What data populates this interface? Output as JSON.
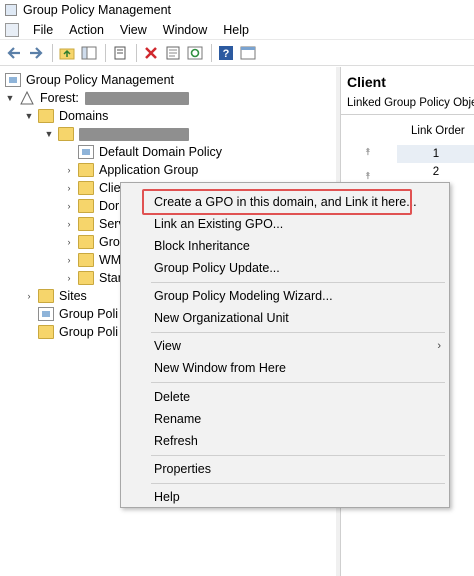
{
  "window": {
    "title": "Group Policy Management"
  },
  "menubar": {
    "items": [
      "File",
      "Action",
      "View",
      "Window",
      "Help"
    ]
  },
  "tree": {
    "root": "Group Policy Management",
    "forest_label": "Forest:",
    "domains": "Domains",
    "items": [
      "Default Domain Policy",
      "Application Group",
      "Client",
      "Dor",
      "Serv",
      "Gro",
      "WM",
      "Star"
    ],
    "sites": "Sites",
    "gp_modeling": "Group Poli",
    "gp_results": "Group Poli"
  },
  "right_pane": {
    "title": "Client",
    "tab": "Linked Group Policy Objects",
    "column": "Link Order",
    "rows": [
      "1",
      "2"
    ]
  },
  "context_menu": {
    "items": [
      "Create a GPO in this domain, and Link it here...",
      "Link an Existing GPO...",
      "Block Inheritance",
      "Group Policy Update...",
      "Group Policy Modeling Wizard...",
      "New Organizational Unit",
      "View",
      "New Window from Here",
      "Delete",
      "Rename",
      "Refresh",
      "Properties",
      "Help"
    ]
  },
  "colors": {
    "highlight_border": "#e05252",
    "folder": "#f6d56b",
    "menu_bg": "#f2f2f2"
  }
}
